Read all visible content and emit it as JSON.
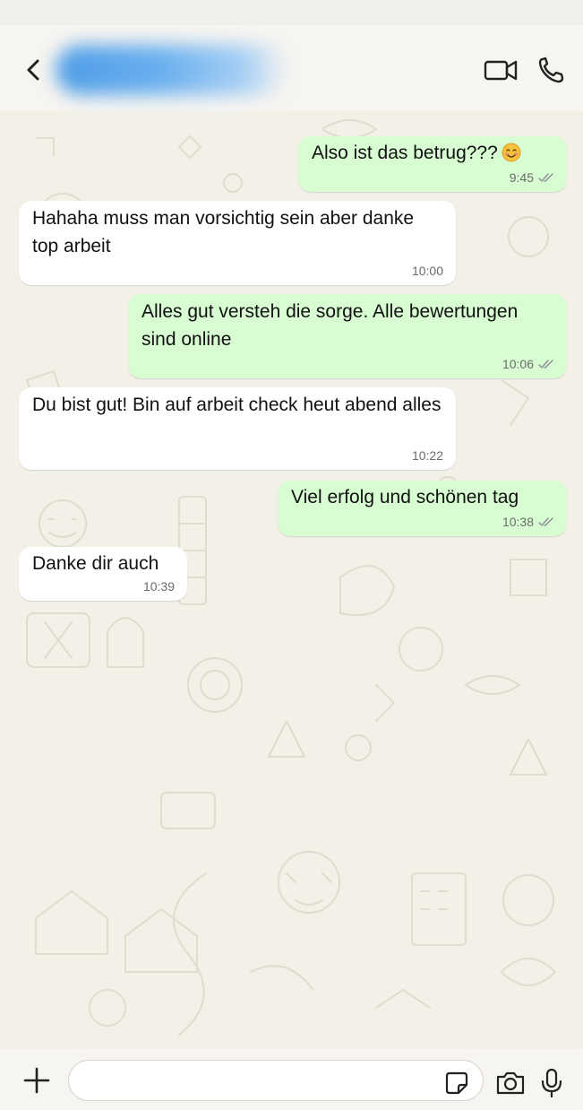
{
  "header": {
    "back_icon": "chevron-left-icon",
    "contact_name_blurred": "",
    "video_icon": "video-camera-icon",
    "call_icon": "phone-icon"
  },
  "messages": [
    {
      "direction": "outgoing",
      "text": "Also ist das betrug???",
      "emoji": "smiling-face-emoji",
      "time": "9:45",
      "status": "read"
    },
    {
      "direction": "incoming",
      "text": "Hahaha muss man vorsichtig sein aber danke top arbeit",
      "time": "10:00"
    },
    {
      "direction": "outgoing",
      "text": "Alles gut versteh die sorge. Alle bewertungen sind online",
      "time": "10:06",
      "status": "read"
    },
    {
      "direction": "incoming",
      "text": "Du bist gut! Bin auf arbeit check heut abend alles",
      "time": "10:22"
    },
    {
      "direction": "outgoing",
      "text": "Viel erfolg und schönen tag",
      "time": "10:38",
      "status": "read"
    },
    {
      "direction": "incoming",
      "text": "Danke dir auch",
      "time": "10:39"
    }
  ],
  "composer": {
    "attach_icon": "plus-icon",
    "input_value": "",
    "input_placeholder": "",
    "sticker_icon": "sticker-icon",
    "camera_icon": "camera-icon",
    "mic_icon": "microphone-icon"
  },
  "colors": {
    "outgoing_bubble": "#d8fdd2",
    "incoming_bubble": "#ffffff",
    "chat_background": "#f3f0e8",
    "tick_color": "#8a8f96"
  }
}
